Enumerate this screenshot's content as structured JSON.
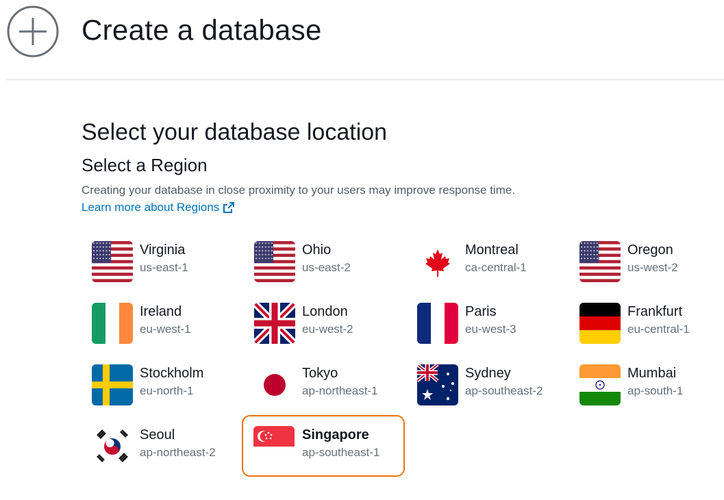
{
  "header": {
    "title": "Create a database",
    "icon": "plus-circle-icon"
  },
  "section": {
    "title": "Select your database location",
    "subtitle": "Select a Region",
    "description": "Creating your database in close proximity to your users may improve response time.",
    "learn_more": "Learn more about Regions"
  },
  "colors": {
    "link": "#0073bb",
    "selected_border": "#ec7211"
  },
  "regions": [
    {
      "name": "Virginia",
      "code": "us-east-1",
      "flag": "usa-flag-icon"
    },
    {
      "name": "Ohio",
      "code": "us-east-2",
      "flag": "usa-flag-icon"
    },
    {
      "name": "Montreal",
      "code": "ca-central-1",
      "flag": "canada-flag-icon"
    },
    {
      "name": "Oregon",
      "code": "us-west-2",
      "flag": "usa-flag-icon"
    },
    {
      "name": "Ireland",
      "code": "eu-west-1",
      "flag": "ireland-flag-icon"
    },
    {
      "name": "London",
      "code": "eu-west-2",
      "flag": "uk-flag-icon"
    },
    {
      "name": "Paris",
      "code": "eu-west-3",
      "flag": "france-flag-icon"
    },
    {
      "name": "Frankfurt",
      "code": "eu-central-1",
      "flag": "germany-flag-icon"
    },
    {
      "name": "Stockholm",
      "code": "eu-north-1",
      "flag": "sweden-flag-icon"
    },
    {
      "name": "Tokyo",
      "code": "ap-northeast-1",
      "flag": "japan-flag-icon"
    },
    {
      "name": "Sydney",
      "code": "ap-southeast-2",
      "flag": "australia-flag-icon"
    },
    {
      "name": "Mumbai",
      "code": "ap-south-1",
      "flag": "india-flag-icon"
    },
    {
      "name": "Seoul",
      "code": "ap-northeast-2",
      "flag": "korea-flag-icon"
    },
    {
      "name": "Singapore",
      "code": "ap-southeast-1",
      "flag": "singapore-flag-icon",
      "selected": true
    }
  ]
}
